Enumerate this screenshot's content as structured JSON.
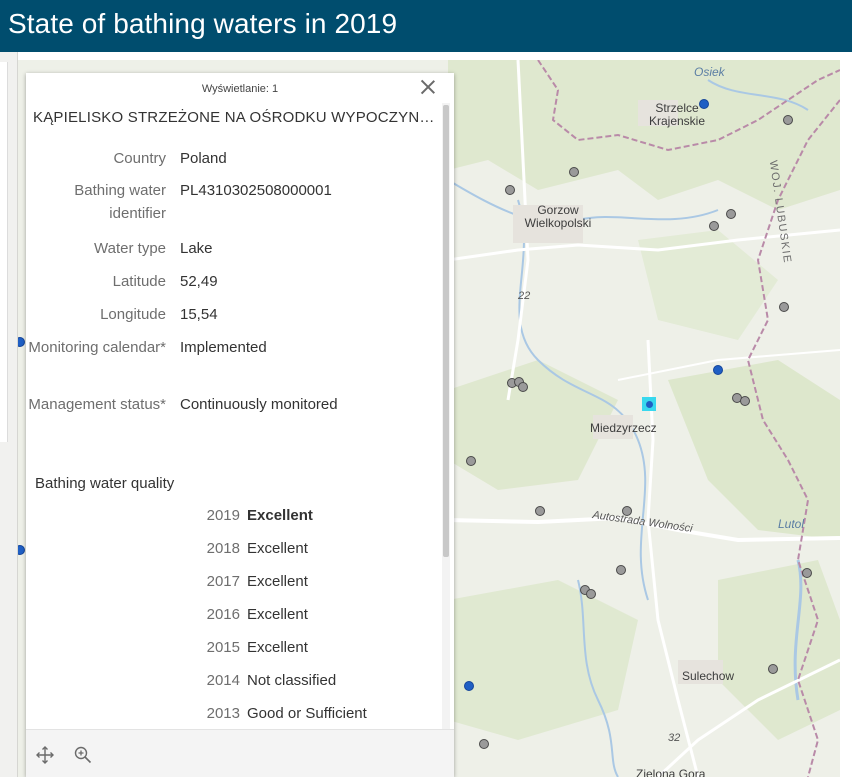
{
  "header": {
    "title": "State of bathing waters in 2019"
  },
  "popup": {
    "count_label": "Wyświetlanie: 1",
    "title": "KĄPIELISKO STRZEŻONE NA OŚRODKU WYPOCZYNKOWYM",
    "fields": [
      {
        "label": "Country",
        "value": "Poland"
      },
      {
        "label": "Bathing water identifier",
        "value": "PL4310302508000001"
      },
      {
        "label": "Water type",
        "value": "Lake"
      },
      {
        "label": "Latitude",
        "value": "52,49"
      },
      {
        "label": "Longitude",
        "value": "15,54"
      },
      {
        "label": "Monitoring calendar*",
        "value": "Implemented"
      },
      {
        "label": "Management status*",
        "value": "Continuously monitored"
      }
    ],
    "quality_heading": "Bathing water quality",
    "quality": [
      {
        "year": "2019",
        "value": "Excellent"
      },
      {
        "year": "2018",
        "value": "Excellent"
      },
      {
        "year": "2017",
        "value": "Excellent"
      },
      {
        "year": "2016",
        "value": "Excellent"
      },
      {
        "year": "2015",
        "value": "Excellent"
      },
      {
        "year": "2014",
        "value": "Not classified"
      },
      {
        "year": "2013",
        "value": "Good or Sufficient"
      }
    ],
    "footer": {
      "pan_icon": "pan-icon",
      "zoom_icon": "zoom-to-icon"
    }
  },
  "map": {
    "labels": {
      "osiek": "Osiek",
      "strzelce": "Strzelce Krajenskie",
      "gorzow": "Gorzow Wielkopolski",
      "woj": "WOJ. LUBUSKIE",
      "route22": "22",
      "miedzyrzecz": "Miedzyrzecz",
      "autostrada": "Autostrada Wolności",
      "lutol": "Lutol",
      "sulechow": "Sulechow",
      "zielona": "Zielona Gora",
      "route32": "32"
    },
    "colors": {
      "header": "#004d6e",
      "site_grey": "#9a9a9a",
      "site_blue": "#1f5fc4",
      "selected_highlight": "#38d8ee"
    }
  }
}
